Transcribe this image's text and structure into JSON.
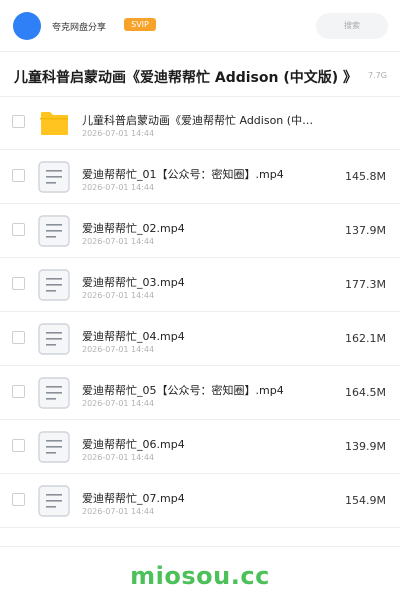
{
  "header": {
    "user_name": "夸克网盘分享",
    "badge": "SVIP",
    "search_placeholder": "搜索"
  },
  "folder": {
    "title": "儿童科普启蒙动画《爱迪帮帮忙 Addison (中文版) 》",
    "total_size": "7.7G"
  },
  "files": [
    {
      "type": "folder",
      "name": "儿童科普启蒙动画《爱迪帮帮忙 Addison (中…",
      "date": "2026-07-01 14:44",
      "size": ""
    },
    {
      "type": "file",
      "name": "爱迪帮帮忙_01【公众号：密知圈】.mp4",
      "date": "2026-07-01 14:44",
      "size": "145.8M"
    },
    {
      "type": "file",
      "name": "爱迪帮帮忙_02.mp4",
      "date": "2026-07-01 14:44",
      "size": "137.9M"
    },
    {
      "type": "file",
      "name": "爱迪帮帮忙_03.mp4",
      "date": "2026-07-01 14:44",
      "size": "177.3M"
    },
    {
      "type": "file",
      "name": "爱迪帮帮忙_04.mp4",
      "date": "2026-07-01 14:44",
      "size": "162.1M"
    },
    {
      "type": "file",
      "name": "爱迪帮帮忙_05【公众号：密知圈】.mp4",
      "date": "2026-07-01 14:44",
      "size": "164.5M"
    },
    {
      "type": "file",
      "name": "爱迪帮帮忙_06.mp4",
      "date": "2026-07-01 14:44",
      "size": "139.9M"
    },
    {
      "type": "file",
      "name": "爱迪帮帮忙_07.mp4",
      "date": "2026-07-01 14:44",
      "size": "154.9M"
    }
  ],
  "icons": {
    "folder": "folder-icon",
    "file": "document-icon"
  },
  "colors": {
    "avatar": "#2f7ff6",
    "badge": "#f7a229",
    "folder_icon": "#ffc41f",
    "watermark": "#4cc159"
  },
  "watermark": "miosou.cc"
}
